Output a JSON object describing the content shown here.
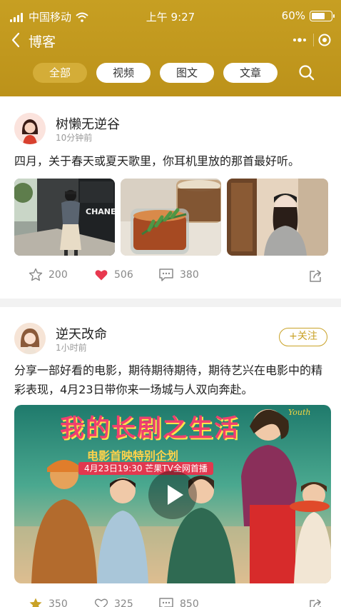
{
  "status_bar": {
    "carrier": "中国移动",
    "time": "上午 9:27",
    "battery": "60%",
    "battery_level": 0.6
  },
  "nav": {
    "title": "博客"
  },
  "tabs": [
    {
      "label": "全部",
      "active": true
    },
    {
      "label": "视频",
      "active": false
    },
    {
      "label": "图文",
      "active": false
    },
    {
      "label": "文章",
      "active": false
    }
  ],
  "posts": [
    {
      "author": "树懒无逆谷",
      "time": "10分钟前",
      "text": "四月，关于春天或夏天歌里，你耳机里放的那首最好听。",
      "images": [
        "street-photo",
        "coffee-photo",
        "selfie-photo"
      ],
      "image_text": "CHANEL",
      "stars": "200",
      "likes": "506",
      "comments": "380"
    },
    {
      "author": "逆天改命",
      "time": "1小时前",
      "follow_label": "+关注",
      "text": "分享一部好看的电影，期待期待期待，期待艺兴在电影中的精彩表现，4月23日带你来一场城与人双向奔赴。",
      "video": {
        "title": "我的长剧之生活",
        "subtitle": "电影首映特别企划",
        "date": "4月23日19:30 芒果TV全网首播",
        "logo": "Youth"
      },
      "stars": "350",
      "likes": "325",
      "comments": "850"
    }
  ],
  "colors": {
    "header": "#c49b20",
    "accent": "#c9a227",
    "like_active": "#e8384f"
  }
}
